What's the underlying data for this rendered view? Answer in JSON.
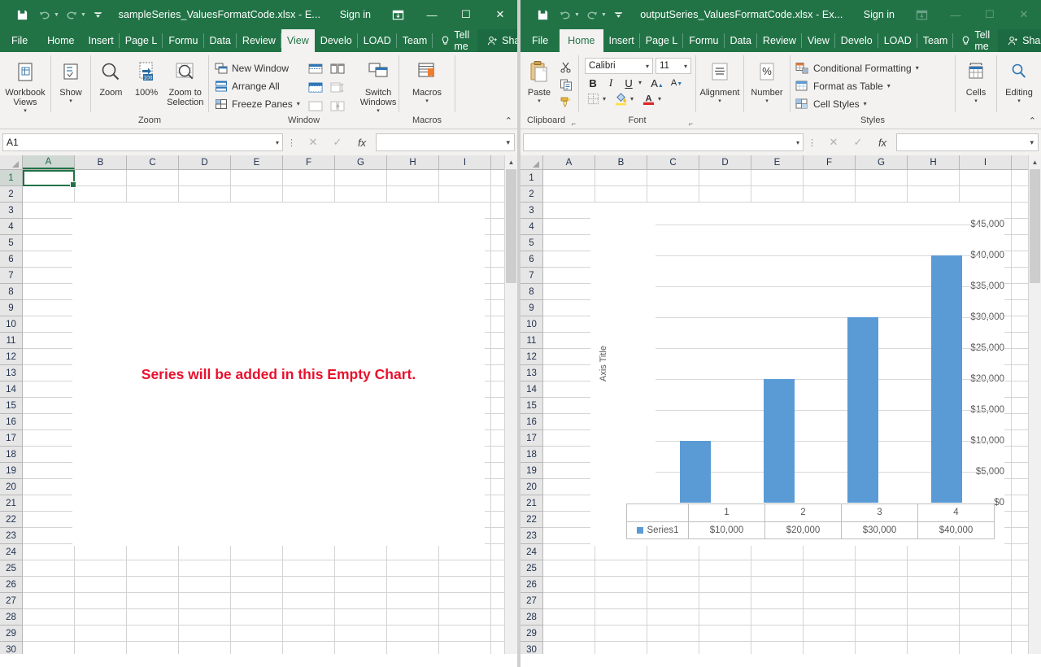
{
  "left_window": {
    "titlebar": {
      "save_icon": "save-icon",
      "undo_icon": "undo-icon",
      "redo_icon": "redo-icon",
      "customize_qat_icon": "chevron-down-icon",
      "title": "sampleSeries_ValuesFormatCode.xlsx  -  E...",
      "signin": "Sign in",
      "ribbon_display_icon": "ribbon-display-options-icon",
      "minimize": "—",
      "maximize": "☐",
      "close": "✕"
    },
    "tabs": [
      {
        "label": "File",
        "active": false
      },
      {
        "label": "Home",
        "active": false
      },
      {
        "label": "Insert",
        "active": false
      },
      {
        "label": "Page L",
        "active": false
      },
      {
        "label": "Formu",
        "active": false
      },
      {
        "label": "Data",
        "active": false
      },
      {
        "label": "Review",
        "active": false
      },
      {
        "label": "View",
        "active": true
      },
      {
        "label": "Develo",
        "active": false
      },
      {
        "label": "LOAD ",
        "active": false
      },
      {
        "label": "Team",
        "active": false
      }
    ],
    "tell_me": "Tell me",
    "share": "Share",
    "ribbon": {
      "groups": [
        {
          "name": "",
          "buttons": [
            {
              "label": "Workbook\nViews",
              "icon": "workbook-views-icon",
              "caret": true
            },
            {
              "label": "Show",
              "icon": "show-icon",
              "caret": true
            }
          ]
        },
        {
          "name": "Zoom",
          "buttons": [
            {
              "label": "Zoom",
              "icon": "zoom-magnifier-icon",
              "caret": false
            },
            {
              "label": "100%",
              "icon": "zoom-100-icon",
              "caret": false
            },
            {
              "label": "Zoom to\nSelection",
              "icon": "zoom-to-selection-icon",
              "caret": false
            }
          ]
        },
        {
          "name": "Window",
          "small_buttons": [
            {
              "label": "New Window",
              "icon": "new-window-icon"
            },
            {
              "label": "Arrange All",
              "icon": "arrange-all-icon"
            },
            {
              "label": "Freeze Panes",
              "icon": "freeze-panes-icon",
              "caret": true
            }
          ],
          "icon_buttons": [
            "split-icon",
            "hide-window-icon",
            "unhide-window-icon",
            "view-side-by-side-icon",
            "synchronous-scrolling-icon",
            "reset-window-position-icon"
          ],
          "buttons": [
            {
              "label": "Switch\nWindows",
              "icon": "switch-windows-icon",
              "caret": true
            }
          ]
        },
        {
          "name": "Macros",
          "buttons": [
            {
              "label": "Macros",
              "icon": "macros-icon",
              "caret": true
            }
          ]
        }
      ],
      "collapse_icon": "chevron-up-icon"
    },
    "formula_bar": {
      "name_box_value": "A1",
      "name_box_caret": "⌄",
      "cancel_icon": "✕",
      "enter_icon": "✓",
      "function_icon": "fx",
      "formula_value": "",
      "expand_caret": "⌄"
    },
    "grid": {
      "columns": [
        "A",
        "B",
        "C",
        "D",
        "E",
        "F",
        "G",
        "H",
        "I"
      ],
      "selected_column": "A",
      "rows": [
        1,
        2,
        3,
        4,
        5,
        6,
        7,
        8,
        9,
        10,
        11,
        12,
        13,
        14,
        15,
        16,
        17,
        18,
        19,
        20,
        21,
        22,
        23,
        24,
        25,
        26,
        27,
        28,
        29,
        30
      ],
      "selected_row": 1,
      "selected_cell": "A1"
    },
    "empty_chart": {
      "message": "Series will be added in this Empty Chart.",
      "message_color": "#e8112d"
    }
  },
  "right_window": {
    "titlebar": {
      "save_icon": "save-icon",
      "undo_icon": "undo-icon",
      "redo_icon": "redo-icon",
      "customize_qat_icon": "chevron-down-icon",
      "title": "outputSeries_ValuesFormatCode.xlsx  -  Ex...",
      "signin": "Sign in",
      "ribbon_display_icon": "ribbon-display-options-icon",
      "minimize": "—",
      "maximize": "☐",
      "close": "✕"
    },
    "tabs": [
      {
        "label": "File",
        "active": false
      },
      {
        "label": "Home",
        "active": true
      },
      {
        "label": "Insert",
        "active": false
      },
      {
        "label": "Page L",
        "active": false
      },
      {
        "label": "Formu",
        "active": false
      },
      {
        "label": "Data",
        "active": false
      },
      {
        "label": "Review",
        "active": false
      },
      {
        "label": "View",
        "active": false
      },
      {
        "label": "Develo",
        "active": false
      },
      {
        "label": "LOAD ",
        "active": false
      },
      {
        "label": "Team",
        "active": false
      }
    ],
    "tell_me": "Tell me",
    "share": "Share",
    "ribbon": {
      "clipboard": {
        "name": "Clipboard",
        "paste_label": "Paste",
        "paste_icon": "paste-icon",
        "cut_icon": "scissors-icon",
        "copy_icon": "copy-icon",
        "format_painter_icon": "format-painter-icon",
        "launcher_icon": "dialog-launcher-icon"
      },
      "font": {
        "name": "Font",
        "font_family": "Calibri",
        "font_size": "11",
        "bold": "B",
        "italic": "I",
        "underline": "U",
        "grow_font": "A",
        "shrink_font": "A",
        "borders_icon": "borders-icon",
        "fill_color_icon": "fill-color-icon",
        "font_color_icon": "font-color-icon",
        "launcher_icon": "dialog-launcher-icon"
      },
      "alignment": {
        "label": "Alignment",
        "icon": "alignment-icon"
      },
      "number": {
        "label": "Number",
        "icon": "percent-icon"
      },
      "styles": {
        "name": "Styles",
        "items": [
          {
            "label": "Conditional Formatting",
            "icon": "conditional-formatting-icon",
            "caret": true
          },
          {
            "label": "Format as Table",
            "icon": "format-as-table-icon",
            "caret": true
          },
          {
            "label": "Cell Styles",
            "icon": "cell-styles-icon",
            "caret": true
          }
        ]
      },
      "cells": {
        "label": "Cells",
        "icon": "cells-icon"
      },
      "editing": {
        "label": "Editing",
        "icon": "editing-find-icon"
      },
      "collapse_icon": "chevron-up-icon"
    },
    "formula_bar": {
      "name_box_value": "",
      "name_box_caret": "⌄",
      "cancel_icon": "✕",
      "enter_icon": "✓",
      "function_icon": "fx",
      "formula_value": "",
      "expand_caret": "⌄"
    },
    "grid": {
      "columns": [
        "A",
        "B",
        "C",
        "D",
        "E",
        "F",
        "G",
        "H",
        "I"
      ],
      "rows": [
        1,
        2,
        3,
        4,
        5,
        6,
        7,
        8,
        9,
        10,
        11,
        12,
        13,
        14,
        15,
        16,
        17,
        18,
        19,
        20,
        21,
        22,
        23,
        24,
        25,
        26,
        27,
        28,
        29,
        30
      ]
    }
  },
  "chart_data": {
    "type": "bar",
    "title": "",
    "categories": [
      "1",
      "2",
      "3",
      "4"
    ],
    "series": [
      {
        "name": "Series1",
        "values": [
          10000,
          20000,
          30000,
          40000
        ],
        "labels": [
          "$10,000",
          "$20,000",
          "$30,000",
          "$40,000"
        ],
        "color": "#5b9bd5"
      }
    ],
    "ylabel": "Axis Title",
    "xlabel": "",
    "ylim": [
      0,
      45000
    ],
    "ytick_values": [
      0,
      5000,
      10000,
      15000,
      20000,
      25000,
      30000,
      35000,
      40000,
      45000
    ],
    "ytick_labels": [
      "$0",
      "$5,000",
      "$10,000",
      "$15,000",
      "$20,000",
      "$25,000",
      "$30,000",
      "$35,000",
      "$40,000",
      "$45,000"
    ],
    "grid": true,
    "legend_position": "data-table",
    "show_data_table": true,
    "data_table": {
      "header_row": [
        "1",
        "2",
        "3",
        "4"
      ],
      "rows": [
        {
          "name": "Series1",
          "values": [
            "$10,000",
            "$20,000",
            "$30,000",
            "$40,000"
          ]
        }
      ]
    }
  }
}
